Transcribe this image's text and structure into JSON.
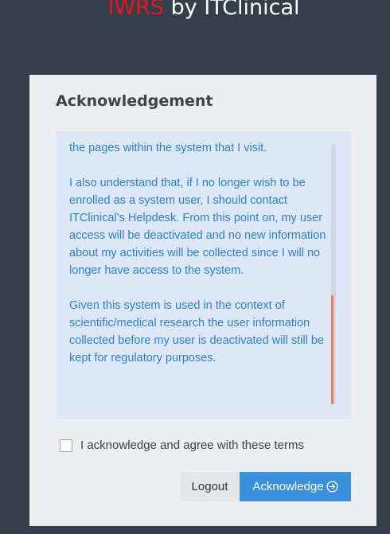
{
  "header": {
    "brand": "IWRS",
    "title_rest": " by ITClinical",
    "brand_color": "#e8161f"
  },
  "card": {
    "title": "Acknowledgement",
    "terms_paragraphs": [
      "the pages within the system that I visit.",
      "I also understand that, if I no longer wish to be enrolled as a system user, I should contact ITClinical’s Helpdesk. From this point on, my user access will be deactivated and no new information about my activities will be collected since I will no longer have access to the system.",
      "Given this system is used in the context of scientific/medical research the user information collected before my user is deactivated will still be kept for regulatory purposes."
    ],
    "scroll": {
      "position": 0.58,
      "visible_fraction": 0.42,
      "thumb_color": "#f07a52"
    },
    "agree": {
      "label": "I acknowledge and agree with these terms",
      "checked": false
    },
    "buttons": {
      "logout_label": "Logout",
      "acknowledge_label": "Acknowledge",
      "acknowledge_icon": "arrow-right-circle-icon",
      "acknowledge_color": "#3a90db"
    }
  }
}
